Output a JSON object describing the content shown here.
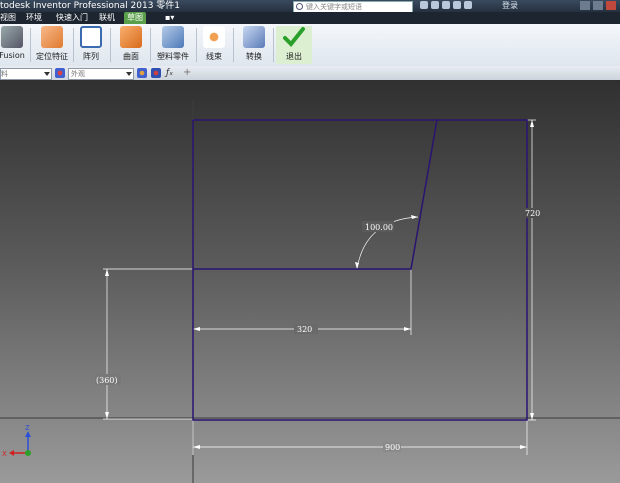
{
  "window": {
    "title": "todesk Inventor Professional 2013    零件1",
    "search_placeholder": "键入关键字或短语",
    "login_label": "登录"
  },
  "menu": {
    "tabs": [
      "视图",
      "环境",
      "快速入门",
      "联机",
      "草图"
    ],
    "active_tab": "草图"
  },
  "ribbon": {
    "buttons": [
      {
        "label": "Fusion",
        "icon": "fusion-icon"
      },
      {
        "label": "定位特征",
        "icon": "work-features-icon"
      },
      {
        "label": "阵列",
        "icon": "pattern-icon"
      },
      {
        "label": "曲面",
        "icon": "surface-icon"
      },
      {
        "label": "塑料零件",
        "icon": "plastic-part-icon"
      },
      {
        "label": "线束",
        "icon": "harness-icon"
      },
      {
        "label": "转换",
        "icon": "convert-icon"
      },
      {
        "label": "退出",
        "icon": "finish-sketch-checkmark-icon"
      }
    ]
  },
  "propbar": {
    "left_combo": "料",
    "appearance_combo": "外观"
  },
  "sketch": {
    "line_color": "#2a1470",
    "dim_color": "#ffffff",
    "dimensions": {
      "angle": "100.00",
      "width_upper": "320",
      "height_right": "720",
      "height_left": "(360)",
      "width_total": "900"
    }
  },
  "triad": {
    "z_label": "Z",
    "x_label": "X",
    "z_color": "#2a4fd8",
    "x_color": "#d02020",
    "origin_color": "#2aa02a"
  }
}
